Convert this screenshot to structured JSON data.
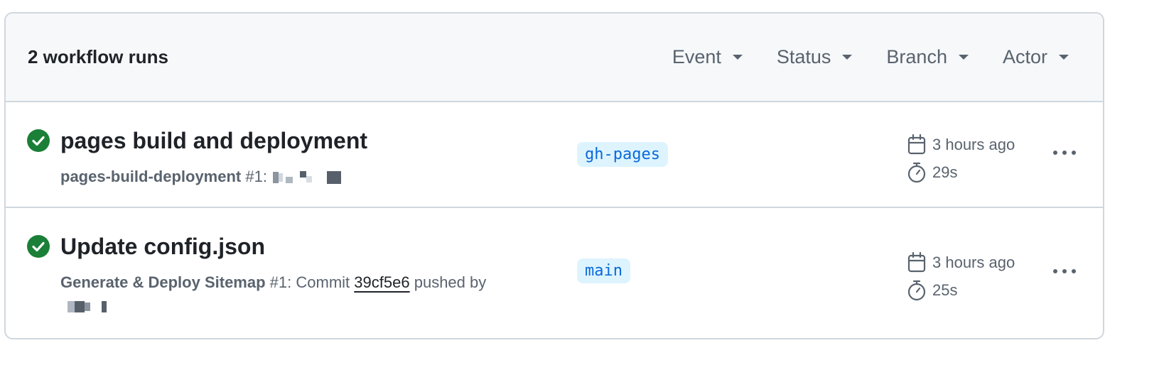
{
  "header": {
    "run_count": "2 workflow runs",
    "filters": [
      "Event",
      "Status",
      "Branch",
      "Actor"
    ]
  },
  "runs": [
    {
      "title": "pages build and deployment",
      "workflow": "pages-build-deployment",
      "run_number": "#1:",
      "branch": "gh-pages",
      "time_ago": "3 hours ago",
      "duration": "29s",
      "status": "success"
    },
    {
      "title": "Update config.json",
      "workflow": "Generate & Deploy Sitemap",
      "run_number": "#1:",
      "commit_prefix": "Commit",
      "commit_sha": "39cf5e6",
      "pushed_by": "pushed by",
      "branch": "main",
      "time_ago": "3 hours ago",
      "duration": "25s",
      "status": "success"
    }
  ],
  "colors": {
    "success": "#1a7f37",
    "branch_bg": "#ddf4ff",
    "branch_fg": "#0969da",
    "muted": "#59636e"
  }
}
